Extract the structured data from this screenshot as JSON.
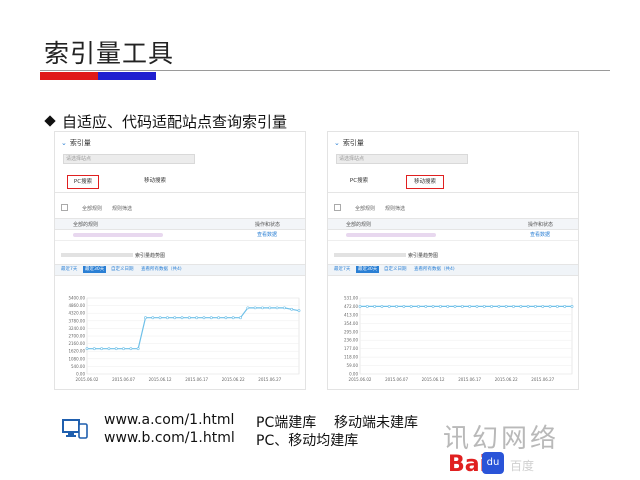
{
  "slide": {
    "title": "索引量工具",
    "bullet": "自适应、代码适配站点查询索引量",
    "colors": {
      "red_bar": "#e01818",
      "blue_bar": "#1f1fd0",
      "accent": "#2a7fd4",
      "selected_tab_border": "#e02020"
    }
  },
  "panels": [
    {
      "header": "索引量",
      "site_placeholder": "请选择站点",
      "tabs": [
        {
          "label": "PC搜索",
          "selected": true
        },
        {
          "label": "移动搜索",
          "selected": false
        }
      ],
      "checks": [
        "全部规则",
        "规则筛选"
      ],
      "table_headers": {
        "rule": "全部的规则",
        "op": "操作和状态"
      },
      "row_link": "查看数据",
      "chart_caption": "索引量趋势图",
      "toolbar": [
        "最近7天",
        "最近30天",
        "自定义日期",
        "查看所有数据（共4)"
      ],
      "chart_data": {
        "type": "line",
        "x": [
          "2015.06.02",
          "2015.06.03",
          "2015.06.04",
          "2015.06.05",
          "2015.06.06",
          "2015.06.07",
          "2015.06.08",
          "2015.06.09",
          "2015.06.10",
          "2015.06.11",
          "2015.06.12",
          "2015.06.13",
          "2015.06.14",
          "2015.06.15",
          "2015.06.16",
          "2015.06.17",
          "2015.06.18",
          "2015.06.19",
          "2015.06.20",
          "2015.06.21",
          "2015.06.22",
          "2015.06.23",
          "2015.06.24",
          "2015.06.25",
          "2015.06.26",
          "2015.06.27",
          "2015.06.28",
          "2015.06.29",
          "2015.06.30",
          "2015.07.01"
        ],
        "values": [
          1800,
          1800,
          1800,
          1800,
          1800,
          1800,
          1800,
          1800,
          4000,
          4000,
          4000,
          4000,
          4000,
          4000,
          4000,
          4000,
          4000,
          4000,
          4000,
          4000,
          4000,
          4000,
          4700,
          4700,
          4700,
          4700,
          4700,
          4700,
          4600,
          4500
        ],
        "y_ticks": [
          "0.00",
          "540.00",
          "1080.00",
          "1620.00",
          "2160.00",
          "2700.00",
          "3240.00",
          "3780.00",
          "4320.00",
          "4860.00",
          "5400.00"
        ],
        "ylim": [
          0,
          5400
        ],
        "x_ticks": [
          "2015.06.02",
          "2015.06.07",
          "2015.06.12",
          "2015.06.17",
          "2015.06.22",
          "2015.06.27"
        ],
        "line_color": "#6fc0e8"
      }
    },
    {
      "header": "索引量",
      "site_placeholder": "请选择站点",
      "tabs": [
        {
          "label": "PC搜索",
          "selected": false
        },
        {
          "label": "移动搜索",
          "selected": true
        }
      ],
      "checks": [
        "全部规则",
        "规则筛选"
      ],
      "table_headers": {
        "rule": "全部的规则",
        "op": "操作和状态"
      },
      "row_link": "查看数据",
      "chart_caption": "索引量趋势图",
      "toolbar": [
        "最近7天",
        "最近30天",
        "自定义日期",
        "查看所有数据（共4)"
      ],
      "chart_data": {
        "type": "line",
        "x": [
          "2015.06.02",
          "2015.06.03",
          "2015.06.04",
          "2015.06.05",
          "2015.06.06",
          "2015.06.07",
          "2015.06.08",
          "2015.06.09",
          "2015.06.10",
          "2015.06.11",
          "2015.06.12",
          "2015.06.13",
          "2015.06.14",
          "2015.06.15",
          "2015.06.16",
          "2015.06.17",
          "2015.06.18",
          "2015.06.19",
          "2015.06.20",
          "2015.06.21",
          "2015.06.22",
          "2015.06.23",
          "2015.06.24",
          "2015.06.25",
          "2015.06.26",
          "2015.06.27",
          "2015.06.28",
          "2015.06.29",
          "2015.06.30",
          "2015.07.01"
        ],
        "values": [
          472,
          472,
          472,
          472,
          472,
          472,
          472,
          472,
          472,
          472,
          472,
          472,
          472,
          472,
          472,
          472,
          472,
          472,
          472,
          472,
          472,
          472,
          472,
          472,
          472,
          472,
          472,
          472,
          472,
          472
        ],
        "y_ticks": [
          "0.00",
          "59.00",
          "118.00",
          "177.00",
          "236.00",
          "295.00",
          "354.00",
          "413.00",
          "472.00",
          "531.00"
        ],
        "ylim": [
          0,
          531
        ],
        "x_ticks": [
          "2015.06.02",
          "2015.06.07",
          "2015.06.12",
          "2015.06.17",
          "2015.06.22",
          "2015.06.27"
        ],
        "line_color": "#6fc0e8"
      }
    }
  ],
  "footer": {
    "url1": "www.a.com/1.html",
    "url2": "www.b.com/1.html",
    "status1": "PC端建库",
    "status2": "PC、移动均建库",
    "status3": "移动端未建库",
    "device_icon": "desktop-mobile-icon"
  },
  "watermark": {
    "text": "讯幻网络",
    "bai": "Bai",
    "du": "du",
    "sub": "百度"
  }
}
